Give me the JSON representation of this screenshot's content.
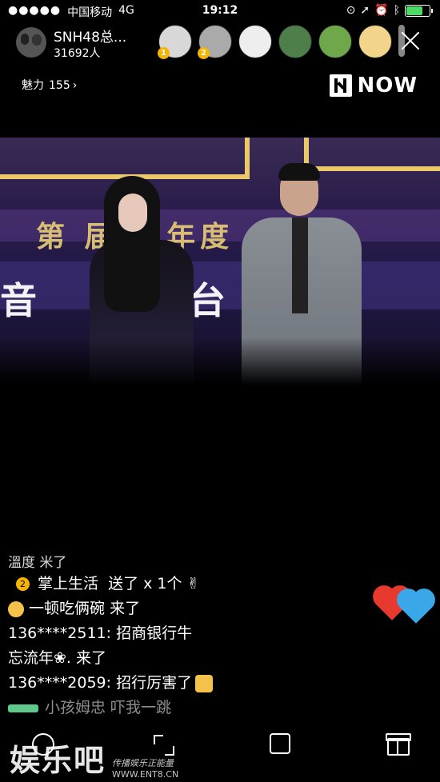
{
  "status_bar": {
    "signal": "●●●●●",
    "carrier": "中国移动",
    "network": "4G",
    "time": "19:12",
    "right_icons": [
      "lock-rotation-icon",
      "location-icon",
      "alarm-icon",
      "bluetooth-icon",
      "battery-icon"
    ],
    "battery_level": 0.65,
    "battery_color": "#4cd964"
  },
  "header": {
    "host_name": "SNH48总...",
    "viewer_count": "31692人",
    "viewers": [
      {
        "rank": "1",
        "color": "#d8d8d8"
      },
      {
        "rank": "2",
        "color": "#aaaaaa"
      },
      {
        "rank": "",
        "color": "#eeeeee"
      },
      {
        "rank": "",
        "color": "#4e7f4a"
      },
      {
        "rank": "",
        "color": "#6ea84a"
      },
      {
        "rank": "",
        "color": "#f2d58a"
      }
    ]
  },
  "charm": {
    "label": "魅力",
    "value": "155",
    "arrow": "›"
  },
  "brand": {
    "name": "NOW"
  },
  "chat": {
    "line0": "溫度 米了",
    "gift": {
      "level": "2",
      "user": "掌上生活",
      "action": "送了 x 1个"
    },
    "line2_user": "一顿吃俩碗",
    "line2_action": "来了",
    "line3_uid": "136****2511:",
    "line3_msg": "招商银行牛",
    "line4": "忘流年❀. 来了",
    "line5_uid": "136****2059:",
    "line5_msg": "招行厉害了",
    "line6": "小孩姆忠   吓我一跳"
  },
  "hearts": {
    "red": "#e8392f",
    "blue": "#3aa7e8"
  },
  "watermark": {
    "main": "娱乐吧",
    "sub1": "传播娱乐正能量",
    "sub2": "WWW.ENT8.CN"
  }
}
